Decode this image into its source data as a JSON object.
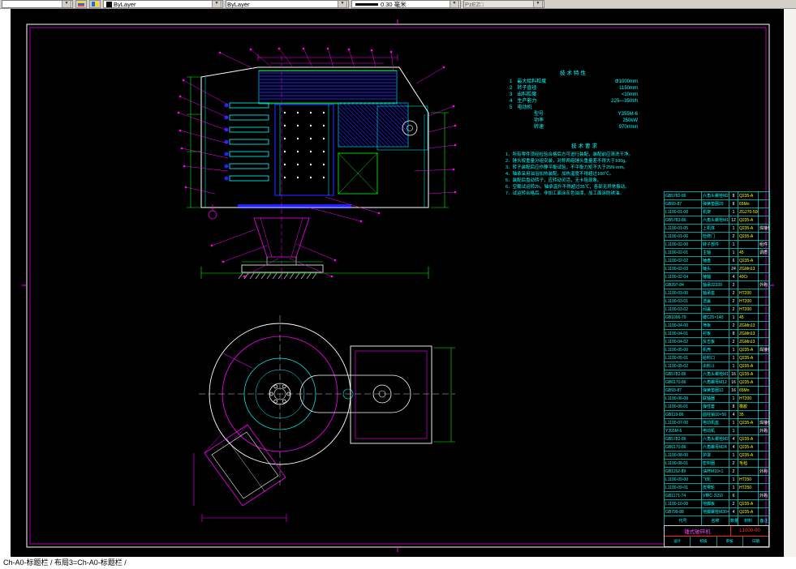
{
  "window": {
    "bottom_tabs_text": "Ch-A0-标题栏 / 布局3=Ch-A0-标题栏 /"
  },
  "toolbar": {
    "color_control": {
      "value": "ByLayer"
    },
    "linetype_control": {
      "value": "ByLayer"
    },
    "lineweight_control": {
      "value": "0.30 毫米"
    },
    "plotstyle_control": {
      "value": "PzEZ□"
    }
  },
  "colors": {
    "canvas": "#000000",
    "frame_white": "#ffffff",
    "dimension_green": "#00ff00",
    "leader_magenta": "#ff00ff",
    "part_cyan": "#00ffff",
    "hatch_blue": "#2222ff",
    "highlight_red": "#ff0000",
    "material_yellow": "#ffff00"
  },
  "notes": {
    "spec": {
      "title": "技术特性",
      "items": [
        {
          "label": "最大给料粒度",
          "value": "Φ1000mm"
        },
        {
          "label": "转子直径",
          "value": "1150mm"
        },
        {
          "label": "出料粒度",
          "value": "<10mm"
        },
        {
          "label": "生产能力",
          "value": "225—350t/h"
        },
        {
          "label": "电动机",
          "value": ""
        }
      ],
      "motor": [
        {
          "label": "型号",
          "value": "Y355M-6"
        },
        {
          "label": "功率",
          "value": "250kW"
        },
        {
          "label": "转速",
          "value": "970r/min"
        }
      ]
    },
    "requirements": {
      "title": "技术要求",
      "items": [
        "所有零件须经检验合格后方可进行装配，装配前应清洗干净。",
        "锤头按重量分组安装，对称两组锤头重量差不得大于100g。",
        "转子装配后应作静平衡试验，不平衡力矩不大于25N·mm。",
        "轴承采用油浴加热装配，加热温度不得超过100℃。",
        "装配后盘动转子，应转动灵活，无卡阻现象。",
        "空载试运转2h，轴承温升不得超过35℃，各部无异常振动。",
        "试运转合格后，非加工面涂灰色油漆，加工面涂防锈油。"
      ]
    }
  },
  "bom": {
    "header": [
      "代号",
      "名称",
      "数量",
      "材料",
      "备注"
    ],
    "rows": [
      [
        "GB5782-86",
        "六角头螺栓M20×80",
        "8",
        "Q235-A",
        ""
      ],
      [
        "GB93-87",
        "弹簧垫圈20",
        "8",
        "65Mn",
        ""
      ],
      [
        "L1190-01-00",
        "机架",
        "1",
        "ZG270-500",
        ""
      ],
      [
        "GB5783-86",
        "六角头螺栓M16×50",
        "12",
        "Q235-A",
        ""
      ],
      [
        "L1190-01-05",
        "上机体",
        "1",
        "Q235-A",
        "焊接件"
      ],
      [
        "L1190-01-06",
        "检修门",
        "2",
        "Q235-A",
        ""
      ],
      [
        "L1190-02-00",
        "转子部件",
        "1",
        "",
        "组件"
      ],
      [
        "L1190-02-01",
        "主轴",
        "1",
        "45",
        "调质"
      ],
      [
        "L1190-02-02",
        "锤盘",
        "6",
        "Q235-A",
        ""
      ],
      [
        "L1190-02-03",
        "锤头",
        "24",
        "ZGMn13",
        ""
      ],
      [
        "L1190-02-04",
        "锤轴",
        "4",
        "40Cr",
        ""
      ],
      [
        "GB297-84",
        "轴承32320",
        "2",
        "",
        "外购"
      ],
      [
        "L1190-03-00",
        "轴承座",
        "2",
        "HT200",
        ""
      ],
      [
        "L1190-03-01",
        "透盖",
        "2",
        "HT200",
        ""
      ],
      [
        "L1190-03-02",
        "闷盖",
        "2",
        "HT200",
        ""
      ],
      [
        "GB1096-79",
        "键C25×140",
        "1",
        "45",
        ""
      ],
      [
        "L1190-04-00",
        "筛板",
        "2",
        "ZGMn13",
        ""
      ],
      [
        "L1190-04-01",
        "衬板",
        "8",
        "ZGMn13",
        ""
      ],
      [
        "L1190-04-02",
        "反击板",
        "2",
        "ZGMn13",
        ""
      ],
      [
        "L1190-05-00",
        "机壳",
        "1",
        "Q235-A",
        "焊接件"
      ],
      [
        "L1190-05-01",
        "给料口",
        "1",
        "Q235-A",
        ""
      ],
      [
        "L1190-05-02",
        "出料斗",
        "1",
        "Q235-A",
        ""
      ],
      [
        "GB5782-86",
        "六角头螺栓M12×40",
        "16",
        "Q235-A",
        ""
      ],
      [
        "GB6170-86",
        "六角螺母M12",
        "16",
        "Q235-A",
        ""
      ],
      [
        "GB93-87",
        "弹簧垫圈12",
        "16",
        "65Mn",
        ""
      ],
      [
        "L1190-06-00",
        "联轴器",
        "1",
        "HT200",
        ""
      ],
      [
        "L1190-06-01",
        "弹性套",
        "8",
        "橡胶",
        ""
      ],
      [
        "GB119-86",
        "圆柱销10×50",
        "4",
        "35",
        ""
      ],
      [
        "L1190-07-00",
        "电动机座",
        "1",
        "Q235-A",
        "焊接件"
      ],
      [
        "Y355M-6",
        "电动机",
        "1",
        "",
        "外购"
      ],
      [
        "GB5782-86",
        "六角头螺栓M24×100",
        "4",
        "Q235-A",
        ""
      ],
      [
        "GB6170-86",
        "六角螺母M24",
        "4",
        "Q235-A",
        ""
      ],
      [
        "L1190-08-00",
        "护罩",
        "1",
        "Q235-A",
        ""
      ],
      [
        "L1190-08-01",
        "密封圈",
        "2",
        "毛毡",
        ""
      ],
      [
        "GB1152-89",
        "油杯M10×1",
        "2",
        "",
        "外购"
      ],
      [
        "L1190-09-00",
        "飞轮",
        "1",
        "HT250",
        ""
      ],
      [
        "L1190-09-01",
        "皮带轮",
        "1",
        "HT250",
        ""
      ],
      [
        "GB1171-74",
        "V带C-3150",
        "6",
        "",
        "外购"
      ],
      [
        "L1190-10-00",
        "地脚板",
        "2",
        "Q235-A",
        ""
      ],
      [
        "GB799-88",
        "地脚螺栓M30×400",
        "4",
        "Q235-A",
        ""
      ]
    ]
  },
  "title_block": {
    "product_name": "锤式破碎机",
    "drawing_no": "L1000-00",
    "signature_labels": [
      "设计",
      "校核",
      "审核",
      "日期"
    ]
  }
}
